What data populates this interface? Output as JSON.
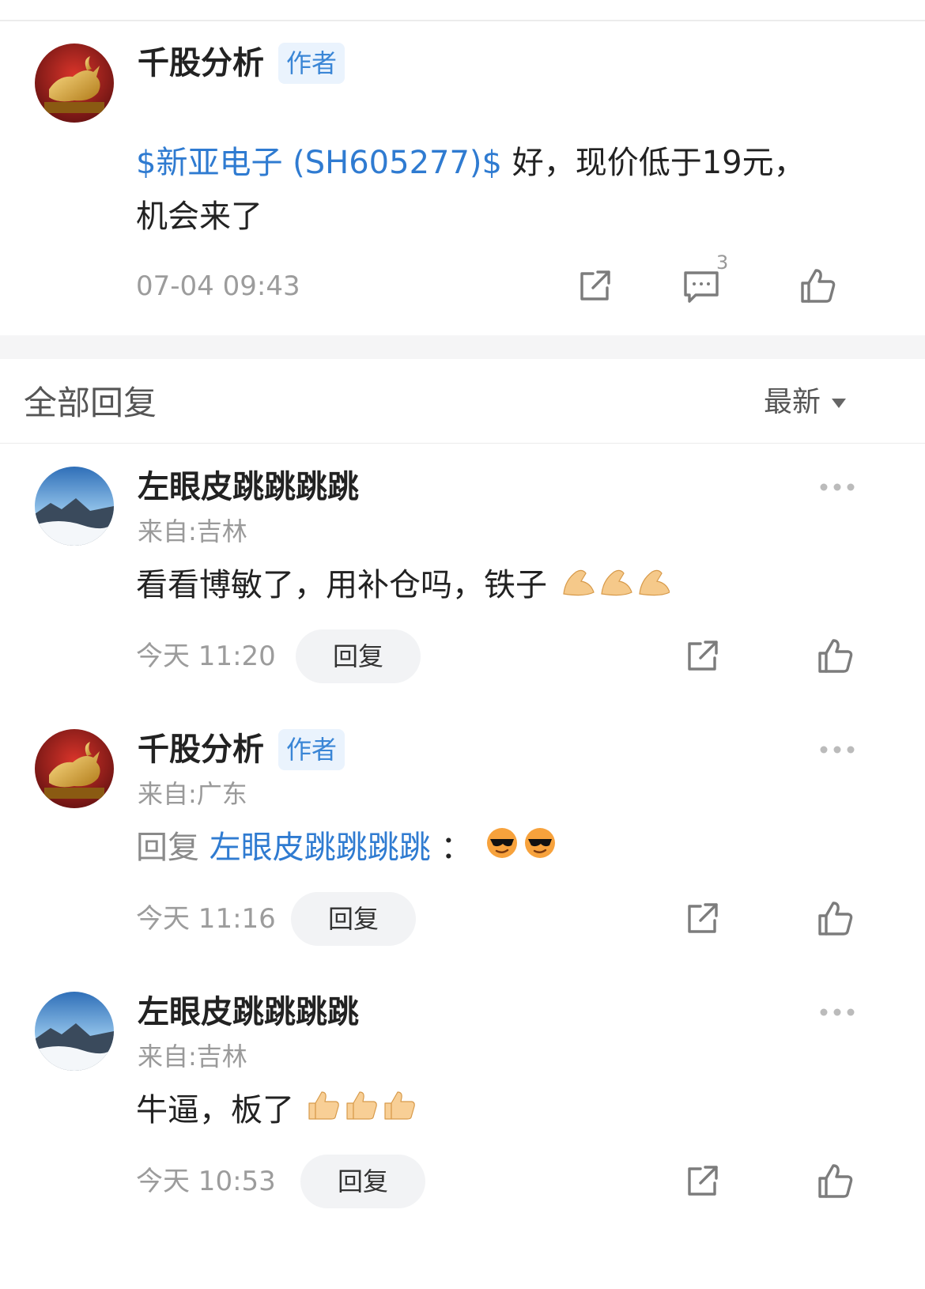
{
  "post": {
    "author": "千股分析",
    "author_badge": "作者",
    "stock_link": "$新亚电子 (SH605277)$",
    "text_line1": " 好，现价低于19元，",
    "text_line2": "机会来了",
    "time": "07-04 09:43",
    "comment_count": "3"
  },
  "replies_header": {
    "title": "全部回复",
    "sort_label": "最新"
  },
  "replies": [
    {
      "author": "左眼皮跳跳跳跳",
      "location": "来自:吉林",
      "text": "看看博敏了，用补仓吗，铁子",
      "emoji": "pinch-hand-emoji",
      "time": "今天 11:20",
      "reply_label": "回复"
    },
    {
      "author": "千股分析",
      "author_badge": "作者",
      "location": "来自:广东",
      "reply_prefix": "回复 ",
      "reply_to": "左眼皮跳跳跳跳",
      "reply_colon": " ：",
      "emoji": "sunglasses-emoji",
      "time": "今天 11:16",
      "reply_label": "回复"
    },
    {
      "author": "左眼皮跳跳跳跳",
      "location": "来自:吉林",
      "text": "牛逼，板了",
      "emoji": "thumbs-up-emoji",
      "time": "今天 10:53",
      "reply_label": "回复"
    }
  ],
  "colors": {
    "link": "#2f7bd1",
    "badge_bg": "#eaf3fd",
    "badge_text": "#3a86d6",
    "muted": "#9c9c9c"
  },
  "icons": [
    "share-icon",
    "comment-icon",
    "like-icon",
    "more-icon",
    "dropdown-caret-icon"
  ]
}
